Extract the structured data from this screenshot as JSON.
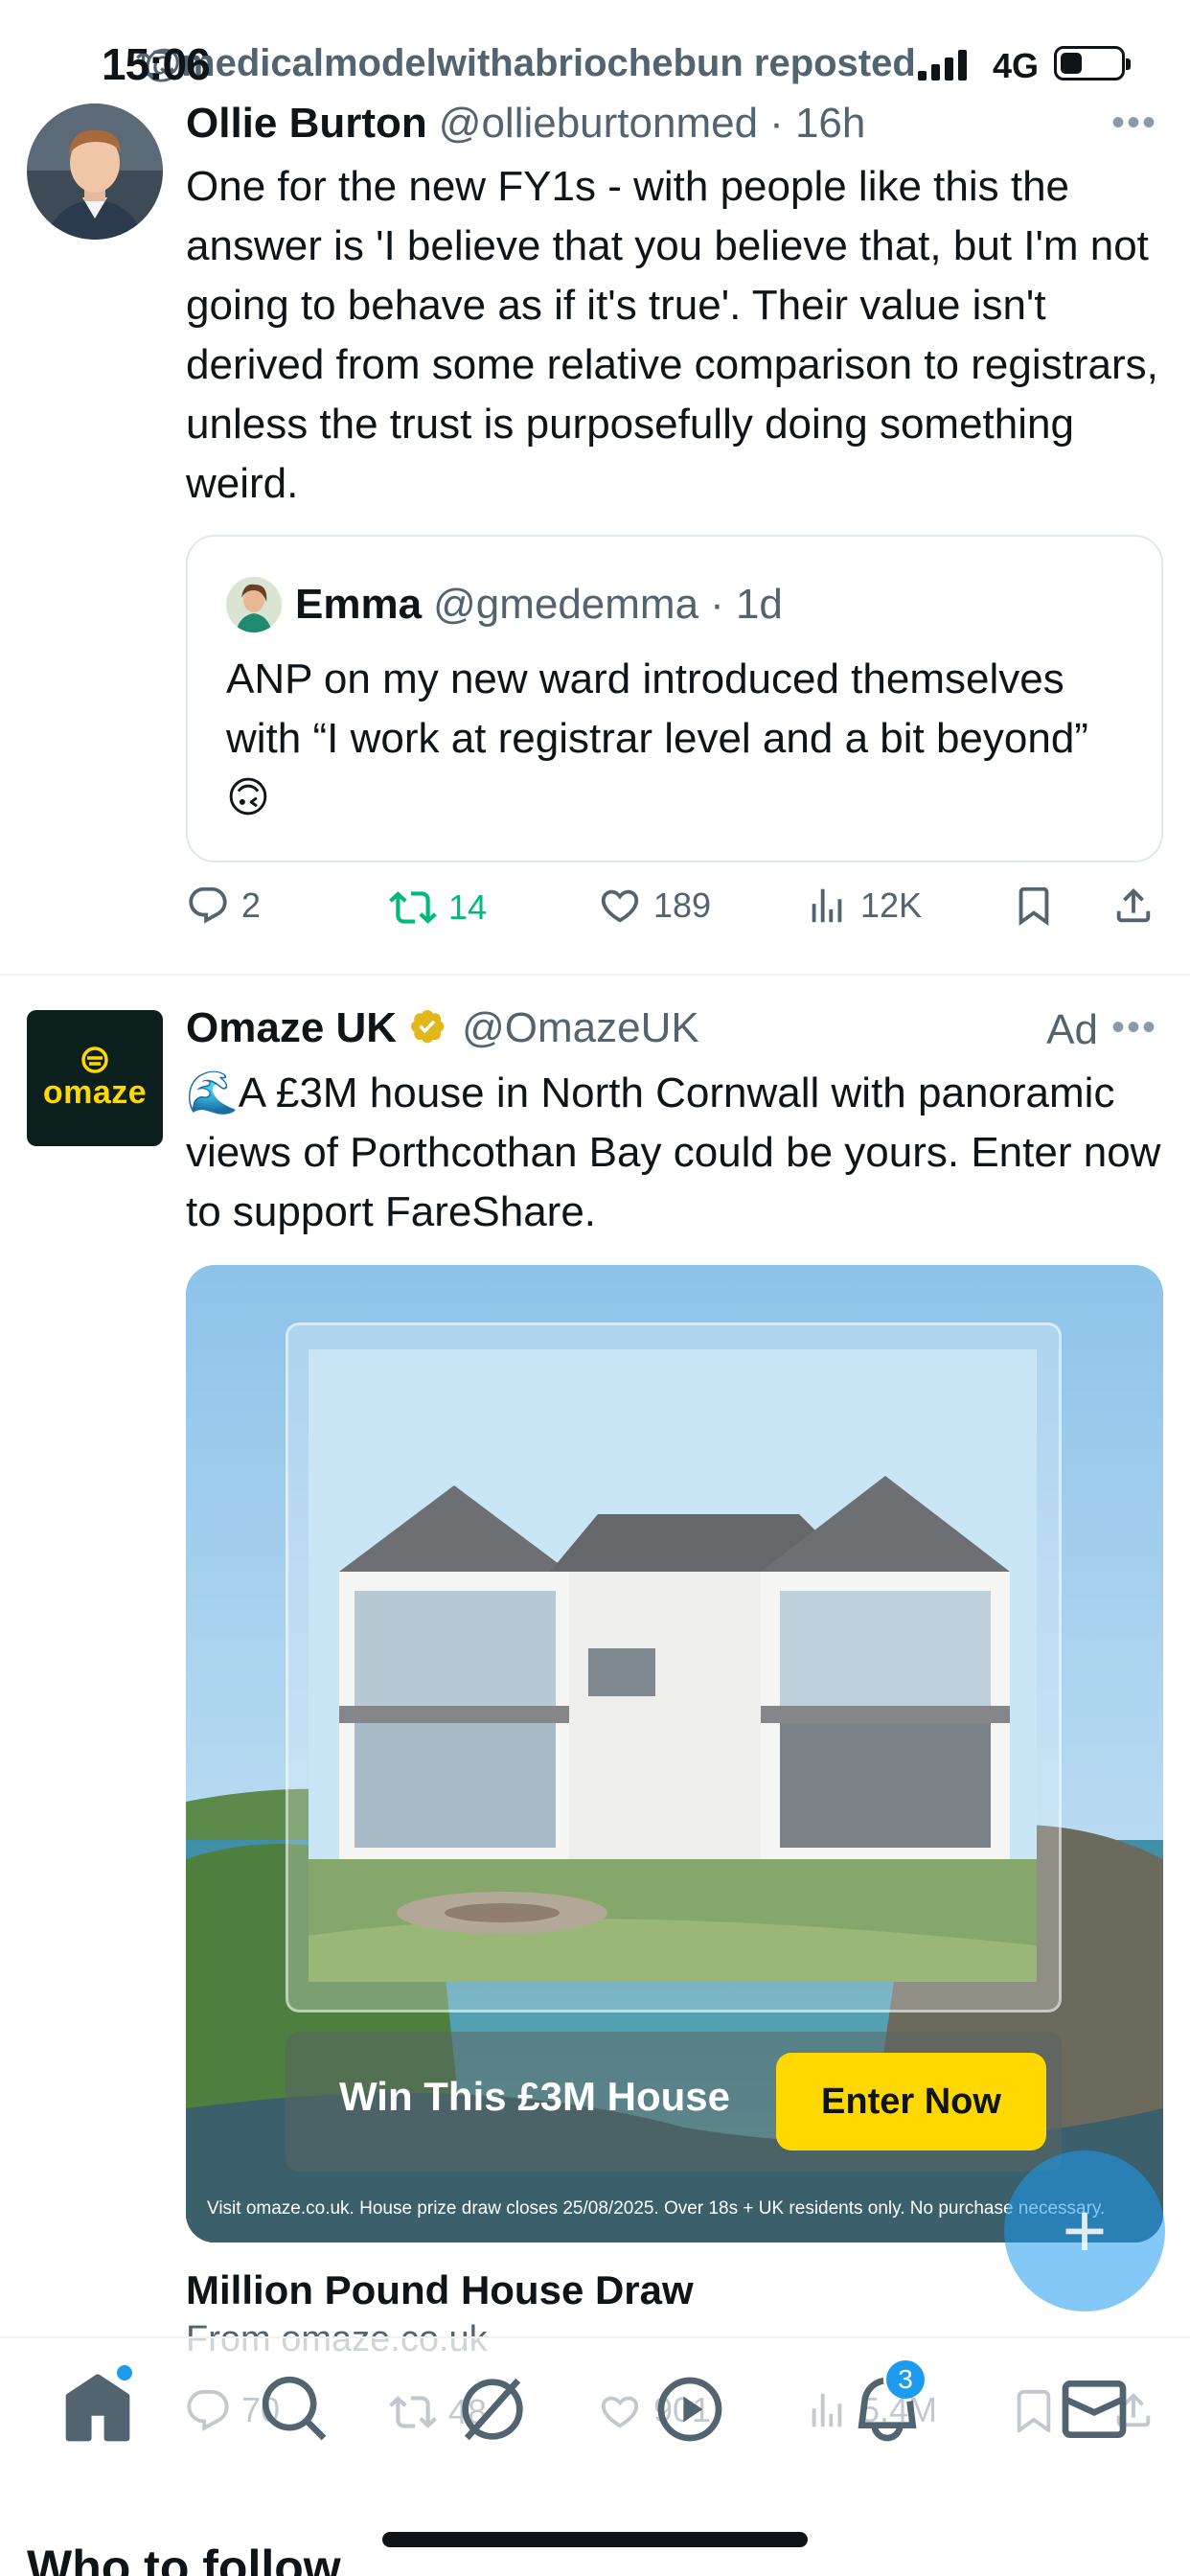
{
  "status_bar": {
    "time": "15:06",
    "network": "4G",
    "repost_text": "@medicalmodelwithabriochebun reposted"
  },
  "tweet1": {
    "name": "Ollie Burton",
    "handle": "@ollieburtonmed",
    "time": "· 16h",
    "text": "One for the new FY1s - with people like this the answer is 'I believe that you believe that, but I'm not going to behave as if it's true'. Their value isn't derived from some relative comparison to registrars, unless the trust is purposefully doing something weird.",
    "quote": {
      "name": "Emma",
      "handle": "@gmedemma",
      "time": "· 1d",
      "text": "ANP on my new ward introduced themselves with “I work at registrar level and a bit beyond” 🙃"
    },
    "actions": {
      "replies": "2",
      "reposts": "14",
      "likes": "189",
      "views": "12K"
    }
  },
  "tweet2": {
    "name": "Omaze UK",
    "handle": "@OmazeUK",
    "ad_label": "Ad",
    "logo_text": "omaze",
    "text": "🌊A £3M house in North Cornwall with panoramic views of Porthcothan Bay could be yours. Enter now to support FareShare.",
    "image": {
      "cta_text": "Win This £3M House",
      "button_label": "Enter Now",
      "disclaimer": "Visit omaze.co.uk. House prize draw closes 25/08/2025. Over 18s + UK residents only. No purchase necessary."
    },
    "card_title": "Million Pound House Draw",
    "card_source": "From omaze.co.uk",
    "actions": {
      "replies": "70",
      "reposts": "48",
      "likes": "901",
      "views": "5.4M"
    }
  },
  "fab": {
    "label": "+"
  },
  "tabbar": {
    "notifications_badge": "3"
  },
  "next_section": "Who to follow",
  "colors": {
    "accent": "#1d9bf0",
    "repost_green": "#00ba7c",
    "omaze_yellow": "#ffd800",
    "omaze_dark": "#0b1f1c"
  }
}
